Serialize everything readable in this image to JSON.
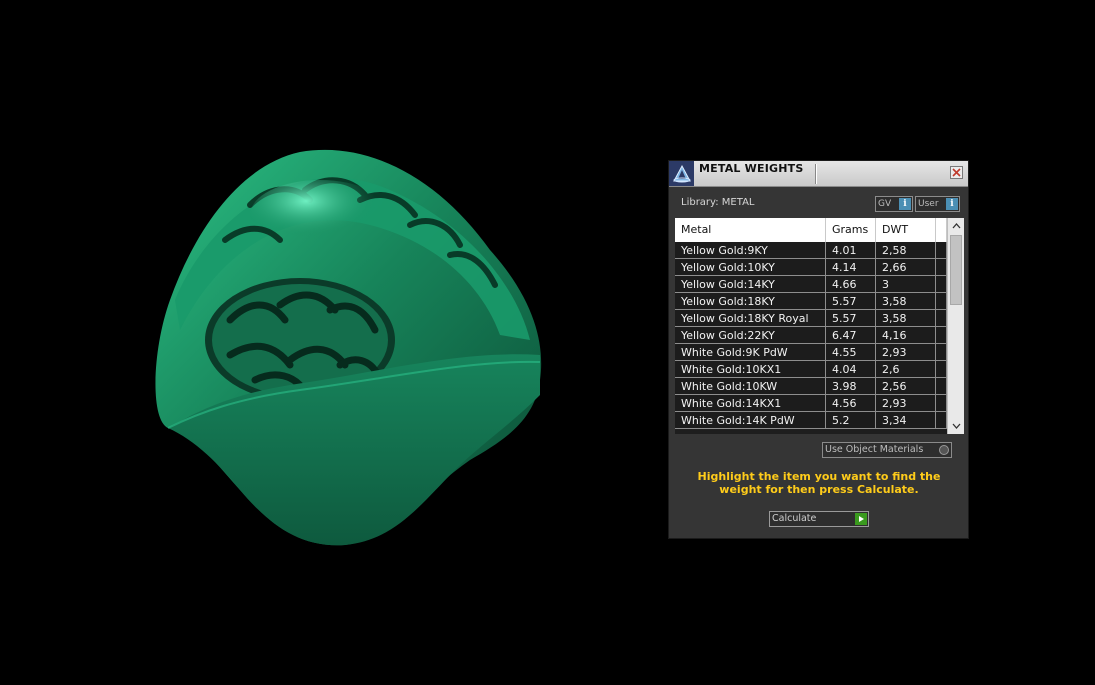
{
  "panel": {
    "title": "METAL WEIGHTS",
    "library_label": "Library: METAL",
    "gv_button": "GV",
    "user_button": "User",
    "info_glyph": "i",
    "use_object_materials": "Use Object Materials",
    "hint": "Highlight the item you want to find the weight for then press Calculate.",
    "calculate_button": "Calculate"
  },
  "table": {
    "headers": [
      "Metal",
      "Grams",
      "DWT"
    ],
    "rows": [
      {
        "metal": "Yellow Gold:9KY",
        "grams": "4.01",
        "dwt": "2,58"
      },
      {
        "metal": "Yellow Gold:10KY",
        "grams": "4.14",
        "dwt": "2,66"
      },
      {
        "metal": "Yellow Gold:14KY",
        "grams": "4.66",
        "dwt": "3"
      },
      {
        "metal": "Yellow Gold:18KY",
        "grams": "5.57",
        "dwt": "3,58"
      },
      {
        "metal": "Yellow Gold:18KY Royal",
        "grams": "5.57",
        "dwt": "3,58"
      },
      {
        "metal": "Yellow Gold:22KY",
        "grams": "6.47",
        "dwt": "4,16"
      },
      {
        "metal": "White Gold:9K PdW",
        "grams": "4.55",
        "dwt": "2,93"
      },
      {
        "metal": "White Gold:10KX1",
        "grams": "4.04",
        "dwt": "2,6"
      },
      {
        "metal": "White Gold:10KW",
        "grams": "3.98",
        "dwt": "2,56"
      },
      {
        "metal": "White Gold:14KX1",
        "grams": "4.56",
        "dwt": "2,93"
      },
      {
        "metal": "White Gold:14K PdW",
        "grams": "5.2",
        "dwt": "3,34"
      }
    ]
  },
  "icons": {
    "app_logo": "triangle-logo-icon",
    "close": "close-icon",
    "scroll_up": "chevron-up-icon",
    "scroll_down": "chevron-down-icon",
    "info": "info-icon",
    "calculate": "play-arrow-icon"
  },
  "colors": {
    "model": "#1f8a5e",
    "hint": "#ffcc1a",
    "panel_bg": "#353535",
    "info_badge": "#4b8fb4",
    "go_button": "#3a9a1e"
  }
}
